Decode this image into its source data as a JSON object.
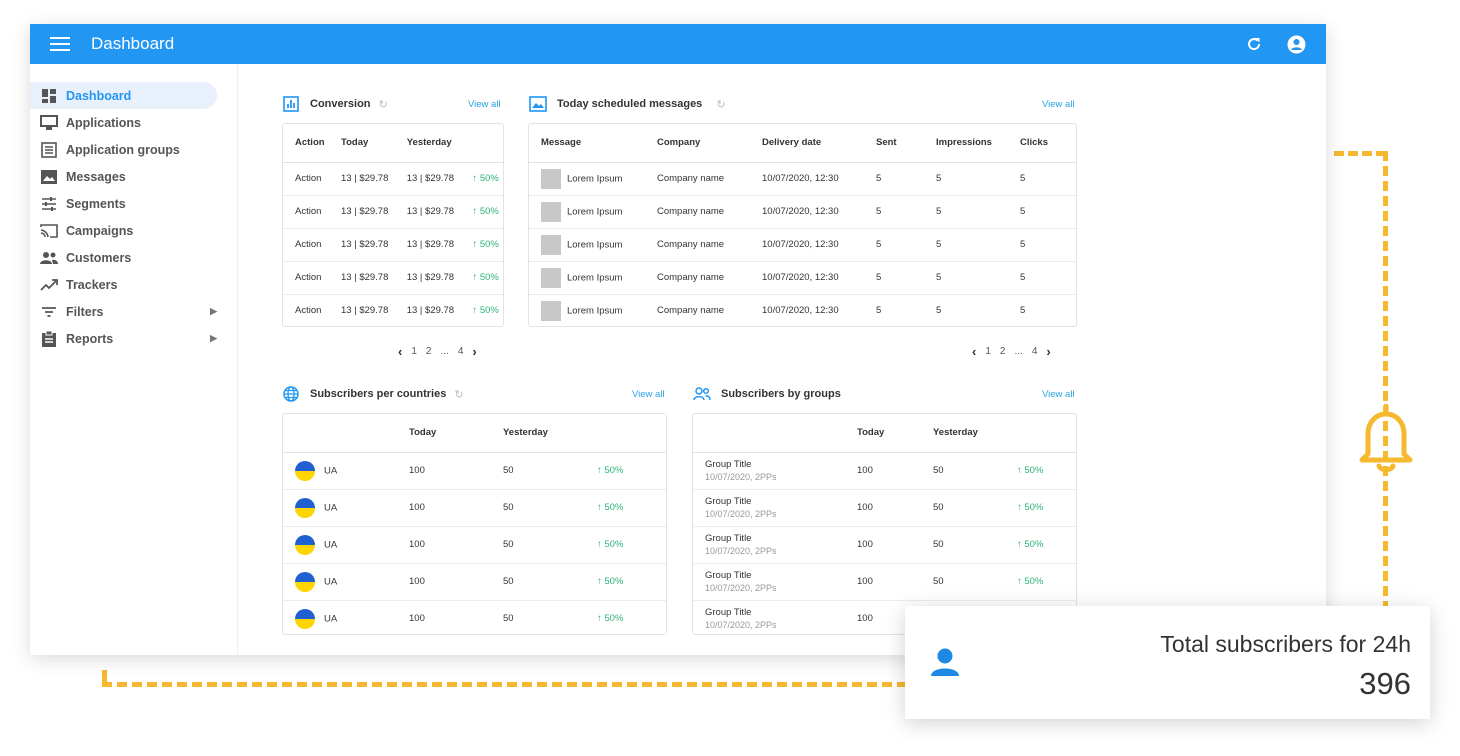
{
  "appbar": {
    "title": "Dashboard"
  },
  "sidebar": {
    "items": [
      {
        "label": "Dashboard",
        "icon": "dashboard-icon"
      },
      {
        "label": "Applications",
        "icon": "monitor-icon"
      },
      {
        "label": "Application groups",
        "icon": "list-icon"
      },
      {
        "label": "Messages",
        "icon": "image-icon"
      },
      {
        "label": "Segments",
        "icon": "sliders-icon"
      },
      {
        "label": "Campaigns",
        "icon": "cast-icon"
      },
      {
        "label": "Customers",
        "icon": "people-icon"
      },
      {
        "label": "Trackers",
        "icon": "trending-icon"
      },
      {
        "label": "Filters",
        "icon": "filter-icon"
      },
      {
        "label": "Reports",
        "icon": "clipboard-icon"
      }
    ]
  },
  "conversion": {
    "title": "Conversion",
    "view_all": "View all",
    "headers": [
      "Action",
      "Today",
      "Yesterday"
    ],
    "rows": [
      {
        "action": "Action",
        "today": "13 | $29.78",
        "yesterday": "13 | $29.78",
        "change": "↑ 50%"
      },
      {
        "action": "Action",
        "today": "13 | $29.78",
        "yesterday": "13 | $29.78",
        "change": "↑ 50%"
      },
      {
        "action": "Action",
        "today": "13 | $29.78",
        "yesterday": "13 | $29.78",
        "change": "↑ 50%"
      },
      {
        "action": "Action",
        "today": "13 | $29.78",
        "yesterday": "13 | $29.78",
        "change": "↑ 50%"
      },
      {
        "action": "Action",
        "today": "13 | $29.78",
        "yesterday": "13 | $29.78",
        "change": "↑ 50%"
      }
    ],
    "pager": {
      "p1": "1",
      "p2": "2",
      "ellipsis": "...",
      "p4": "4"
    }
  },
  "scheduled": {
    "title": "Today scheduled messages",
    "view_all": "View all",
    "headers": [
      "Message",
      "Company",
      "Delivery date",
      "Sent",
      "Impressions",
      "Clicks"
    ],
    "rows": [
      {
        "message": "Lorem Ipsum",
        "company": "Company name",
        "date": "10/07/2020, 12:30",
        "sent": "5",
        "impressions": "5",
        "clicks": "5"
      },
      {
        "message": "Lorem Ipsum",
        "company": "Company name",
        "date": "10/07/2020, 12:30",
        "sent": "5",
        "impressions": "5",
        "clicks": "5"
      },
      {
        "message": "Lorem Ipsum",
        "company": "Company name",
        "date": "10/07/2020, 12:30",
        "sent": "5",
        "impressions": "5",
        "clicks": "5"
      },
      {
        "message": "Lorem Ipsum",
        "company": "Company name",
        "date": "10/07/2020, 12:30",
        "sent": "5",
        "impressions": "5",
        "clicks": "5"
      },
      {
        "message": "Lorem Ipsum",
        "company": "Company name",
        "date": "10/07/2020, 12:30",
        "sent": "5",
        "impressions": "5",
        "clicks": "5"
      }
    ],
    "pager": {
      "p1": "1",
      "p2": "2",
      "ellipsis": "...",
      "p4": "4"
    }
  },
  "countries": {
    "title": "Subscribers per countries",
    "view_all": "View all",
    "headers": [
      "",
      "Today",
      "Yesterday",
      ""
    ],
    "rows": [
      {
        "country": "UA",
        "today": "100",
        "yesterday": "50",
        "change": "↑ 50%"
      },
      {
        "country": "UA",
        "today": "100",
        "yesterday": "50",
        "change": "↑ 50%"
      },
      {
        "country": "UA",
        "today": "100",
        "yesterday": "50",
        "change": "↑ 50%"
      },
      {
        "country": "UA",
        "today": "100",
        "yesterday": "50",
        "change": "↑ 50%"
      },
      {
        "country": "UA",
        "today": "100",
        "yesterday": "50",
        "change": "↑ 50%"
      }
    ]
  },
  "groups": {
    "title": "Subscribers by groups",
    "view_all": "View all",
    "headers": [
      "",
      "Today",
      "Yesterday",
      ""
    ],
    "rows": [
      {
        "title": "Group Title",
        "sub": "10/07/2020, 2PPs",
        "today": "100",
        "yesterday": "50",
        "change": "↑ 50%"
      },
      {
        "title": "Group Title",
        "sub": "10/07/2020, 2PPs",
        "today": "100",
        "yesterday": "50",
        "change": "↑ 50%"
      },
      {
        "title": "Group Title",
        "sub": "10/07/2020, 2PPs",
        "today": "100",
        "yesterday": "50",
        "change": "↑ 50%"
      },
      {
        "title": "Group Title",
        "sub": "10/07/2020, 2PPs",
        "today": "100",
        "yesterday": "50",
        "change": "↑ 50%"
      },
      {
        "title": "Group Title",
        "sub": "10/07/2020, 2PPs",
        "today": "100",
        "yesterday": "",
        "change": ""
      }
    ]
  },
  "total_card": {
    "label": "Total subscribers for 24h",
    "value": "396"
  },
  "colors": {
    "primary": "#2196f3",
    "accent_dash": "#f5b82e",
    "positive": "#2db37a",
    "link": "#29a3e0"
  }
}
